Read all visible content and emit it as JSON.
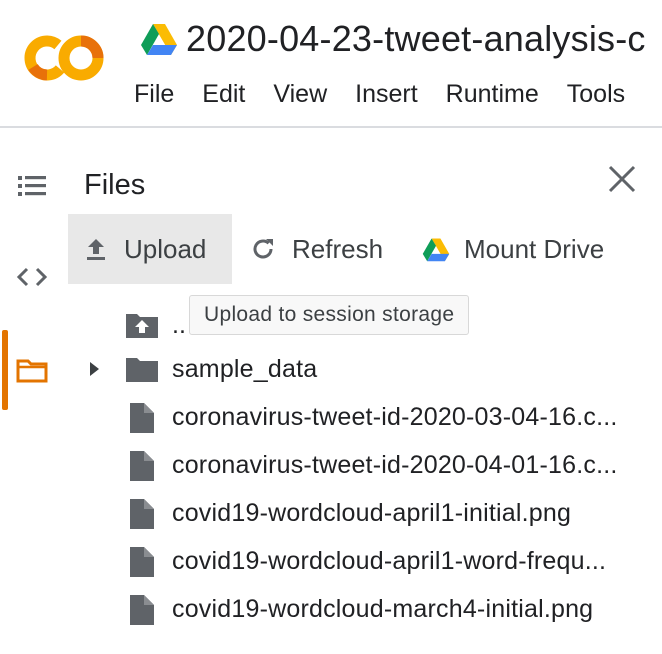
{
  "notebook": {
    "title": "2020-04-23-tweet-analysis-c",
    "logo_text": "CO"
  },
  "menu": [
    "File",
    "Edit",
    "View",
    "Insert",
    "Runtime",
    "Tools"
  ],
  "sidebar_nav": {
    "items": [
      {
        "icon": "table-of-contents-icon"
      },
      {
        "icon": "code-snippets-icon"
      },
      {
        "icon": "folder-icon",
        "active": true
      }
    ]
  },
  "files_panel": {
    "title": "Files",
    "upload_label": "Upload",
    "refresh_label": "Refresh",
    "mount_drive_label": "Mount Drive",
    "tooltip": "Upload to session storage",
    "parent_dir": "..",
    "items": [
      {
        "name": "sample_data",
        "type": "folder"
      },
      {
        "name": "coronavirus-tweet-id-2020-03-04-16.c...",
        "type": "file"
      },
      {
        "name": "coronavirus-tweet-id-2020-04-01-16.c...",
        "type": "file"
      },
      {
        "name": "covid19-wordcloud-april1-initial.png",
        "type": "file"
      },
      {
        "name": "covid19-wordcloud-april1-word-frequ...",
        "type": "file"
      },
      {
        "name": "covid19-wordcloud-march4-initial.png",
        "type": "file"
      }
    ]
  },
  "colors": {
    "colab_orange": "#f9ab00",
    "colab_dark_orange": "#e8710a",
    "active_bar": "#e37400",
    "icon_gray": "#5f6368"
  }
}
